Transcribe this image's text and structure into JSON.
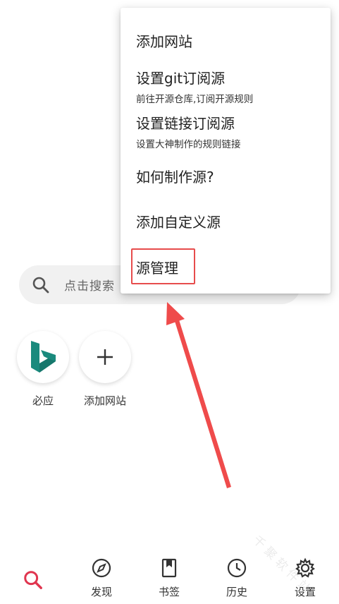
{
  "search": {
    "placeholder": "点击搜索"
  },
  "shortcuts": [
    {
      "label": "必应",
      "icon": "bing-logo-icon"
    },
    {
      "label": "添加网站",
      "icon": "plus-icon"
    }
  ],
  "menu": {
    "items": [
      {
        "title": "添加网站",
        "subtitle": ""
      },
      {
        "title": "设置git订阅源",
        "subtitle": "前往开源仓库,订阅开源规则"
      },
      {
        "title": "设置链接订阅源",
        "subtitle": "设置大神制作的规则链接"
      },
      {
        "title": "如何制作源?",
        "subtitle": ""
      },
      {
        "title": "添加自定义源",
        "subtitle": ""
      },
      {
        "title": "源管理",
        "subtitle": ""
      }
    ],
    "highlighted_item": "源管理"
  },
  "bottom_nav": {
    "items": [
      {
        "label": "",
        "icon": "search-icon",
        "active": true
      },
      {
        "label": "发现",
        "icon": "compass-icon",
        "active": false
      },
      {
        "label": "书签",
        "icon": "bookmark-icon",
        "active": false
      },
      {
        "label": "历史",
        "icon": "clock-icon",
        "active": false
      },
      {
        "label": "设置",
        "icon": "gear-icon",
        "active": false
      }
    ]
  },
  "watermark": {
    "text": "千 聚 软 件 站"
  },
  "colors": {
    "accent": "#e0354f",
    "annotation": "#ef4b4b",
    "bing": "#1a8a7d"
  }
}
